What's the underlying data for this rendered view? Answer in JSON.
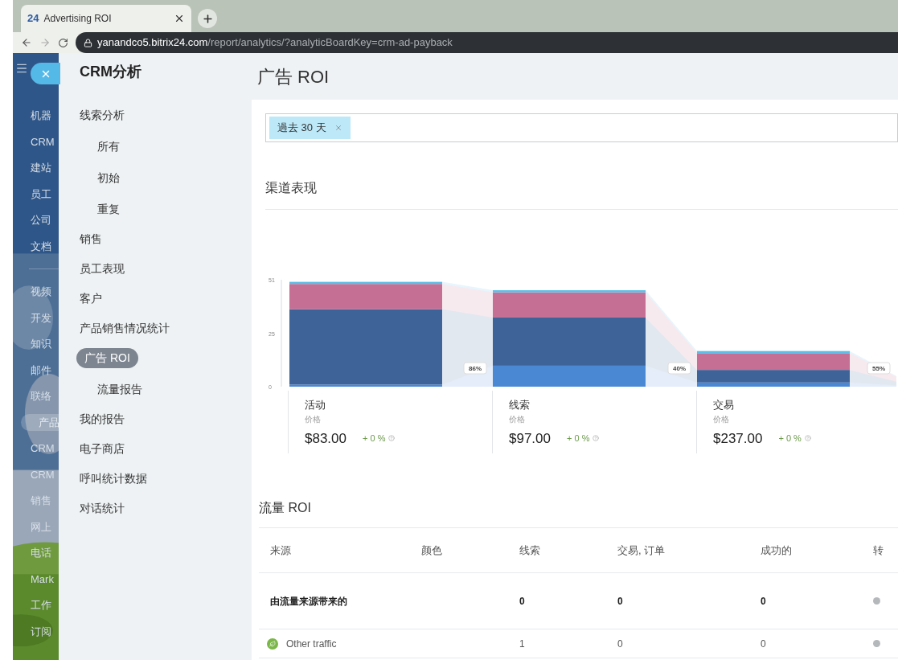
{
  "browser": {
    "tab_logo": "24",
    "tab_title": "Advertising ROI",
    "url_host": "yanandco5.bitrix24.com",
    "url_path": "/report/analytics/?analyticBoardKey=crm-ad-payback"
  },
  "left_menu": {
    "items": [
      {
        "label": "机器",
        "selected": false
      },
      {
        "label": "CRM",
        "selected": false
      },
      {
        "label": "建站",
        "selected": false
      },
      {
        "label": "员工",
        "selected": false
      },
      {
        "label": "公司",
        "selected": false
      },
      {
        "label": "文档",
        "selected": false
      },
      {
        "label": "视频",
        "selected": false
      },
      {
        "label": "开发",
        "selected": false
      },
      {
        "label": "知识",
        "selected": false
      },
      {
        "label": "邮件",
        "selected": false
      },
      {
        "label": "联络",
        "selected": false
      },
      {
        "label": "产品",
        "selected": true
      },
      {
        "label": "CRM",
        "selected": false
      },
      {
        "label": "CRM",
        "selected": false
      },
      {
        "label": "销售",
        "selected": false
      },
      {
        "label": "网上",
        "selected": false
      },
      {
        "label": "电话",
        "selected": false
      },
      {
        "label": "Mark",
        "selected": false
      },
      {
        "label": "工作",
        "selected": false
      },
      {
        "label": "订阅",
        "selected": false
      }
    ]
  },
  "panel": {
    "title": "CRM分析",
    "items": [
      {
        "label": "线索分析",
        "selected": false,
        "children": [
          {
            "label": "所有",
            "selected": false
          },
          {
            "label": "初始",
            "selected": false
          },
          {
            "label": "重复",
            "selected": false
          }
        ]
      },
      {
        "label": "销售",
        "selected": false
      },
      {
        "label": "员工表现",
        "selected": false
      },
      {
        "label": "客户",
        "selected": false
      },
      {
        "label": "产品销售情况统计",
        "selected": false
      },
      {
        "label": "广告 ROI",
        "selected": true,
        "children": [
          {
            "label": "流量报告",
            "selected": false
          }
        ]
      },
      {
        "label": "我的报告",
        "selected": false
      },
      {
        "label": "电子商店",
        "selected": false
      },
      {
        "label": "呼叫统计数据",
        "selected": false
      },
      {
        "label": "对话统计",
        "selected": false
      }
    ]
  },
  "page_title": "广告 ROI",
  "filter": {
    "tags": [
      "過去 30 天"
    ]
  },
  "channel_section": {
    "title": "渠道表现",
    "chart_data": {
      "type": "bar",
      "stacked": true,
      "ylim": [
        0,
        51
      ],
      "yticks": [
        0,
        25,
        51
      ],
      "series": [
        {
          "color": "#4a88d4",
          "values": [
            1,
            10,
            2
          ]
        },
        {
          "color": "#3e6399",
          "values": [
            36,
            23,
            6
          ]
        },
        {
          "color": "#c56f95",
          "values": [
            12,
            12,
            8
          ]
        },
        {
          "color": "#5bbde8",
          "values": [
            1,
            1,
            1
          ]
        }
      ],
      "annotations": [
        "86%",
        "40%",
        "55%"
      ]
    },
    "stages": [
      {
        "name": "活动",
        "metric_label": "价格",
        "value": "$83.00",
        "change": "+ 0 %"
      },
      {
        "name": "线索",
        "metric_label": "价格",
        "value": "$97.00",
        "change": "+ 0 %"
      },
      {
        "name": "交易",
        "metric_label": "价格",
        "value": "$237.00",
        "change": "+ 0 %"
      }
    ]
  },
  "traffic_section": {
    "title": "流量 ROI",
    "columns": [
      "来源",
      "颜色",
      "线索",
      "交易, 订单",
      "成功的",
      "转"
    ],
    "rows": [
      {
        "kind": "total",
        "source": "由流量来源带来的",
        "leads": "0",
        "deals": "0",
        "won": "0"
      },
      {
        "kind": "source",
        "source": "Other traffic",
        "leads": "1",
        "deals": "0",
        "won": "0"
      }
    ]
  }
}
